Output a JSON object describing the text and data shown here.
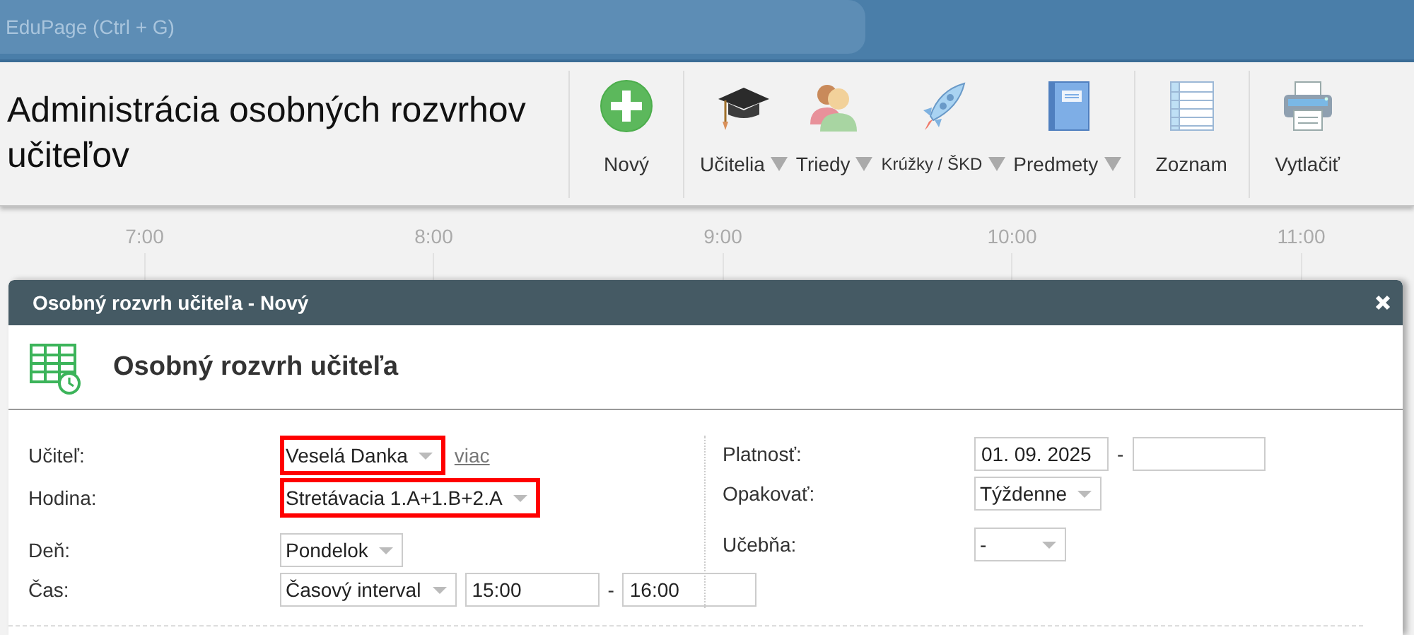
{
  "search": {
    "placeholder": "EduPage (Ctrl + G)"
  },
  "page_title": "Administrácia osobných rozvrhov učiteľov",
  "toolbar": [
    {
      "items": [
        {
          "kind": "button",
          "label": "Nový"
        }
      ]
    },
    {
      "items": [
        {
          "kind": "menu",
          "label": "Učitelia"
        },
        {
          "kind": "menu",
          "label": "Triedy"
        },
        {
          "kind": "menu",
          "label": "Krúžky / ŠKD"
        },
        {
          "kind": "menu",
          "label": "Predmety"
        }
      ]
    },
    {
      "items": [
        {
          "kind": "button",
          "label": "Zoznam"
        }
      ]
    },
    {
      "items": [
        {
          "kind": "button",
          "label": "Vytlačiť"
        }
      ]
    }
  ],
  "timeline": [
    "7:00",
    "8:00",
    "9:00",
    "10:00",
    "11:00"
  ],
  "dialog": {
    "title": "Osobný rozvrh učiteľa - Nový",
    "heading": "Osobný rozvrh učiteľa",
    "columns": [
      {
        "groups": [
          {
            "rows": [
              {
                "label": "Učiteľ:",
                "controls": [
                  {
                    "kind": "select",
                    "value": "Veselá Danka",
                    "highlighted": true
                  },
                  {
                    "kind": "link",
                    "text": "viac"
                  }
                ]
              },
              {
                "label": "Hodina:",
                "controls": [
                  {
                    "kind": "select",
                    "value": "Stretávacia 1.A+1.B+2.A",
                    "highlighted": true
                  }
                ]
              }
            ]
          },
          {
            "rows": [
              {
                "label": "Deň:",
                "controls": [
                  {
                    "kind": "select",
                    "value": "Pondelok",
                    "highlighted": false
                  }
                ]
              },
              {
                "label": "Čas:",
                "controls": [
                  {
                    "kind": "select",
                    "value": "Časový interval",
                    "highlighted": false
                  },
                  {
                    "kind": "text",
                    "value": "15:00"
                  },
                  {
                    "kind": "dash",
                    "text": "-"
                  },
                  {
                    "kind": "text",
                    "value": "16:00"
                  }
                ]
              }
            ]
          }
        ]
      },
      {
        "groups": [
          {
            "rows": [
              {
                "label": "Platnosť:",
                "controls": [
                  {
                    "kind": "text",
                    "value": "01. 09. 2025"
                  },
                  {
                    "kind": "dash",
                    "text": "-"
                  },
                  {
                    "kind": "text"
                  }
                ]
              },
              {
                "label": "Opakovať:",
                "controls": [
                  {
                    "kind": "select",
                    "value": "Týždenne",
                    "highlighted": false
                  }
                ]
              }
            ]
          },
          {
            "rows": [
              {
                "label": "Učebňa:",
                "controls": [
                  {
                    "kind": "select",
                    "value": "-",
                    "highlighted": false
                  }
                ]
              }
            ]
          }
        ]
      }
    ]
  }
}
